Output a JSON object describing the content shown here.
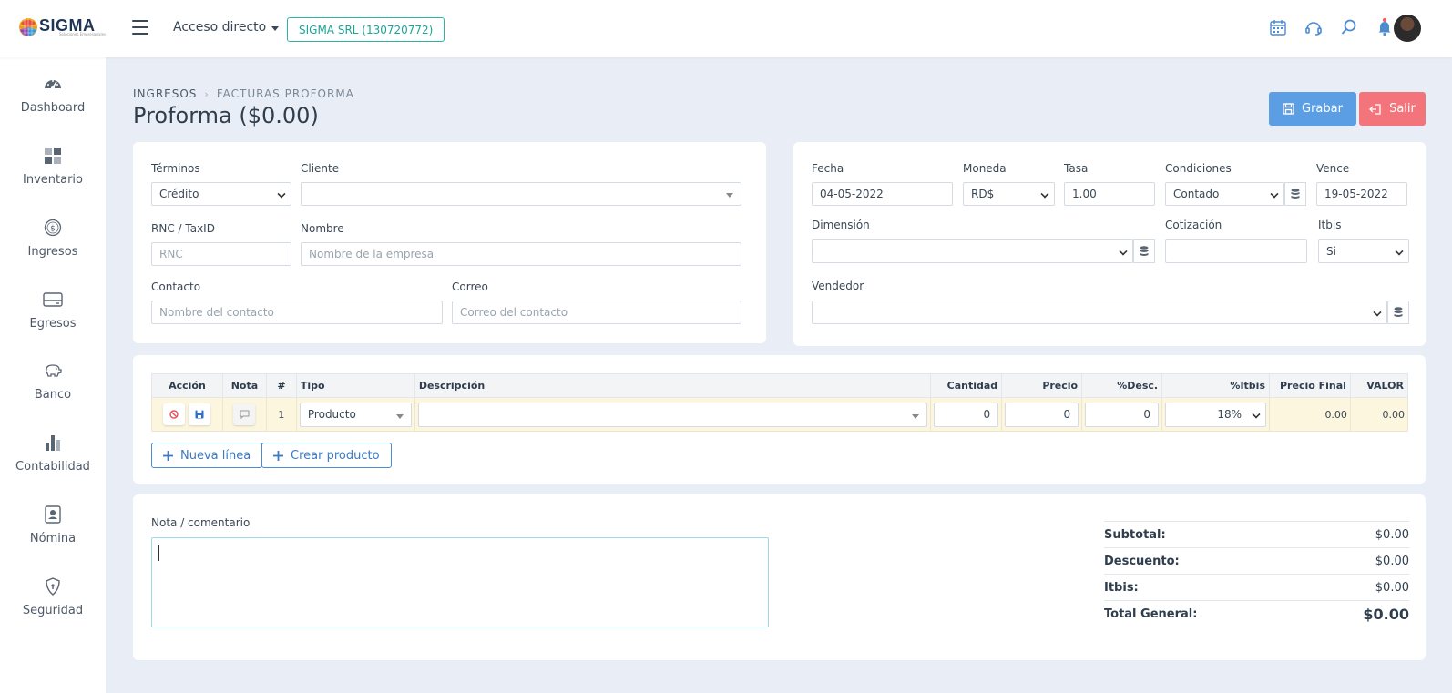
{
  "header": {
    "logo_text": "SIGMA",
    "logo_sub": "Soluciones Empresariales",
    "quick_access": "Acceso directo",
    "company": "SIGMA SRL (130720772)"
  },
  "sidebar": {
    "items": [
      {
        "label": "Dashboard",
        "icon": "gauge-icon"
      },
      {
        "label": "Inventario",
        "icon": "grid-icon"
      },
      {
        "label": "Ingresos",
        "icon": "dollar-coin-icon"
      },
      {
        "label": "Egresos",
        "icon": "card-icon"
      },
      {
        "label": "Banco",
        "icon": "piggy-bank-icon"
      },
      {
        "label": "Contabilidad",
        "icon": "bar-chart-icon"
      },
      {
        "label": "Nómina",
        "icon": "id-badge-icon"
      },
      {
        "label": "Seguridad",
        "icon": "shield-icon"
      }
    ]
  },
  "breadcrumb": {
    "section": "INGRESOS",
    "page": "FACTURAS PROFORMA"
  },
  "page_title": "Proforma ($0.00)",
  "actions": {
    "save": "Grabar",
    "exit": "Salir"
  },
  "form_left": {
    "terminos_label": "Términos",
    "terminos_value": "Crédito",
    "cliente_label": "Cliente",
    "cliente_value": "",
    "rnc_label": "RNC / TaxID",
    "rnc_placeholder": "RNC",
    "nombre_label": "Nombre",
    "nombre_placeholder": "Nombre de la empresa",
    "contacto_label": "Contacto",
    "contacto_placeholder": "Nombre del contacto",
    "correo_label": "Correo",
    "correo_placeholder": "Correo del contacto"
  },
  "form_right": {
    "fecha_label": "Fecha",
    "fecha_value": "04-05-2022",
    "moneda_label": "Moneda",
    "moneda_value": "RD$",
    "tasa_label": "Tasa",
    "tasa_value": "1.00",
    "condiciones_label": "Condiciones",
    "condiciones_value": "Contado",
    "vence_label": "Vence",
    "vence_value": "19-05-2022",
    "dimension_label": "Dimensión",
    "dimension_value": "",
    "cotizacion_label": "Cotización",
    "cotizacion_value": "",
    "itbis_label": "Itbis",
    "itbis_value": "Si",
    "vendedor_label": "Vendedor",
    "vendedor_value": ""
  },
  "table": {
    "headers": [
      "Acción",
      "Nota",
      "#",
      "Tipo",
      "Descripción",
      "Cantidad",
      "Precio",
      "%Desc.",
      "%Itbis",
      "Precio Final",
      "VALOR"
    ],
    "row": {
      "num": "1",
      "tipo": "Producto",
      "descripcion": "",
      "cantidad": "0",
      "precio": "0",
      "desc": "0",
      "itbis": "18%",
      "precio_final": "0.00",
      "valor": "0.00"
    }
  },
  "line_actions": {
    "new_line": "Nueva línea",
    "create_product": "Crear producto"
  },
  "note": {
    "label": "Nota / comentario",
    "value": ""
  },
  "totals": {
    "subtotal_label": "Subtotal:",
    "subtotal": "$0.00",
    "descuento_label": "Descuento:",
    "descuento": "$0.00",
    "itbis_label": "Itbis:",
    "itbis": "$0.00",
    "total_label": "Total General:",
    "total": "$0.00"
  },
  "colors": {
    "primary": "#5b9ee4",
    "danger": "#f3757b",
    "teal": "#2bb3a6",
    "background": "#e9eef6"
  }
}
